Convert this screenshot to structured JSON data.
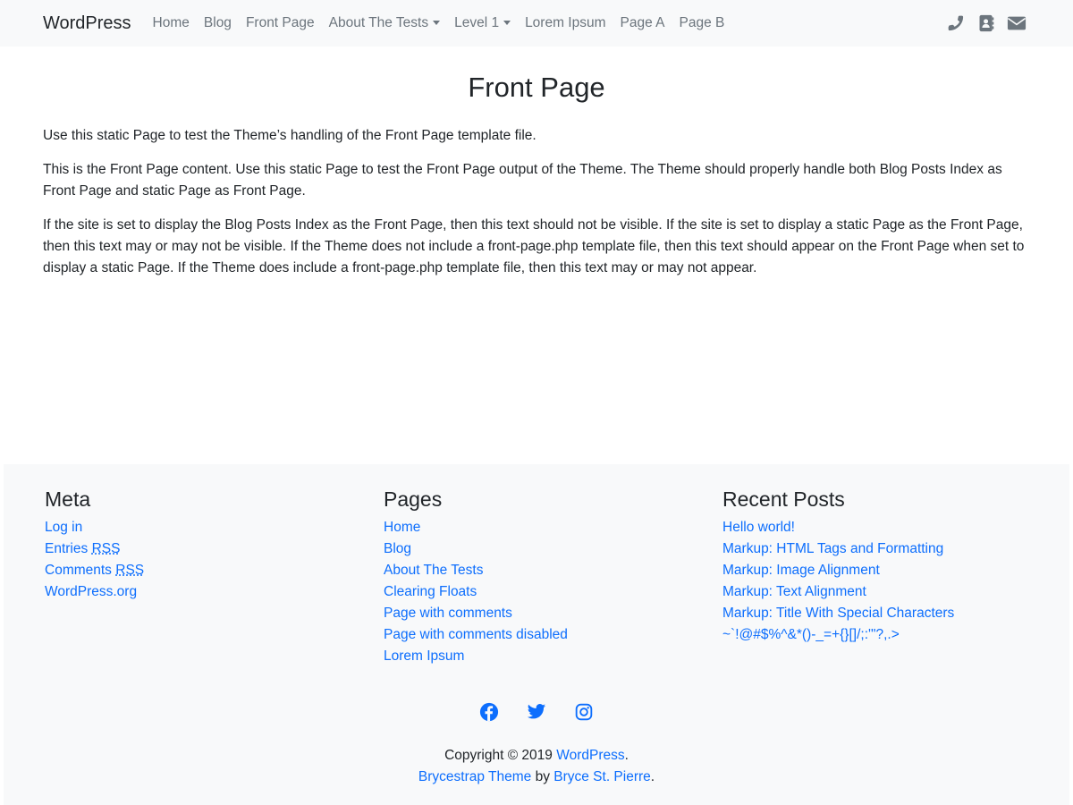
{
  "navbar": {
    "brand": "WordPress",
    "items": [
      {
        "label": "Home"
      },
      {
        "label": "Blog"
      },
      {
        "label": "Front Page"
      },
      {
        "label": "About The Tests"
      },
      {
        "label": "Level 1"
      },
      {
        "label": "Lorem Ipsum"
      },
      {
        "label": "Page A"
      },
      {
        "label": "Page B"
      }
    ],
    "icons": [
      "phone-icon",
      "address-book-icon",
      "envelope-icon"
    ]
  },
  "main": {
    "title": "Front Page",
    "paragraphs": [
      "Use this static Page to test the Theme’s handling of the Front Page template file.",
      "This is the Front Page content. Use this static Page to test the Front Page output of the Theme. The Theme should properly handle both Blog Posts Index as Front Page and static Page as Front Page.",
      "If the site is set to display the Blog Posts Index as the Front Page, then this text should not be visible. If the site is set to display a static Page as the Front Page, then this text may or may not be visible. If the Theme does not include a front-page.php template file, then this text should appear on the Front Page when set to display a static Page. If the Theme does include a front-page.php template file, then this text may or may not appear."
    ]
  },
  "footer": {
    "meta": {
      "title": "Meta",
      "links": [
        {
          "label": "Log in"
        },
        {
          "pre": "Entries ",
          "abbr": "RSS"
        },
        {
          "pre": "Comments ",
          "abbr": "RSS"
        },
        {
          "label": "WordPress.org"
        }
      ]
    },
    "pages": {
      "title": "Pages",
      "links": [
        {
          "label": "Home"
        },
        {
          "label": "Blog"
        },
        {
          "label": "About The Tests"
        },
        {
          "label": "Clearing Floats"
        },
        {
          "label": "Page with comments"
        },
        {
          "label": "Page with comments disabled"
        },
        {
          "label": "Lorem Ipsum"
        }
      ]
    },
    "recent_posts": {
      "title": "Recent Posts",
      "links": [
        {
          "label": "Hello world!"
        },
        {
          "label": "Markup: HTML Tags and Formatting"
        },
        {
          "label": "Markup: Image Alignment"
        },
        {
          "label": "Markup: Text Alignment"
        },
        {
          "label": "Markup: Title With Special Characters"
        },
        {
          "label": "~`!@#$%^&*()-_=+{}[]/;:'\"?,.>"
        }
      ]
    },
    "social_icons": [
      "facebook-icon",
      "twitter-icon",
      "instagram-icon"
    ],
    "copyright": {
      "prefix": "Copyright © 2019 ",
      "site_link": "WordPress",
      "suffix": ".",
      "theme_link": "Brycestrap Theme",
      "by": " by ",
      "author_link": "Bryce St. Pierre",
      "end": "."
    },
    "colors": {
      "link": "#0d6efd",
      "background": "#f8f9fa",
      "text": "#212529",
      "nav_text": "#6c757d"
    }
  }
}
